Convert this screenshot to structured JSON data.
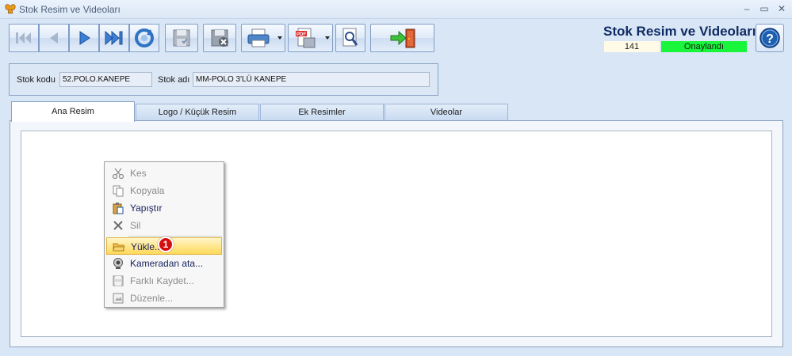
{
  "window": {
    "title": "Stok Resim ve Videoları"
  },
  "header": {
    "title": "Stok Resim ve Videoları",
    "record_no": "141",
    "status": "Onaylandı",
    "status_color": "#19f53a"
  },
  "toolbar": {
    "buttons": [
      {
        "name": "first-record",
        "icon": "first-icon"
      },
      {
        "name": "previous-record",
        "icon": "prev-icon"
      },
      {
        "name": "next-record",
        "icon": "next-icon"
      },
      {
        "name": "last-record",
        "icon": "last-icon"
      },
      {
        "name": "refresh",
        "icon": "refresh-icon"
      },
      {
        "name": "save",
        "icon": "save-icon"
      },
      {
        "name": "delete",
        "icon": "save-delete-icon"
      },
      {
        "name": "print",
        "icon": "printer-icon"
      },
      {
        "name": "export-pdf",
        "icon": "pdf-icon"
      },
      {
        "name": "preview",
        "icon": "search-icon"
      },
      {
        "name": "exit",
        "icon": "exit-icon"
      }
    ]
  },
  "form": {
    "stok_kodu_label": "Stok kodu",
    "stok_kodu_value": "52.POLO.KANEPE",
    "stok_adi_label": "Stok adı",
    "stok_adi_value": "MM-POLO 3'LÜ KANEPE"
  },
  "tabs": [
    {
      "label": "Ana Resim",
      "active": true
    },
    {
      "label": "Logo / Küçük Resim",
      "active": false
    },
    {
      "label": "Ek Resimler",
      "active": false
    },
    {
      "label": "Videolar",
      "active": false
    }
  ],
  "context_menu": {
    "items": [
      {
        "label": "Kes",
        "icon": "scissors-icon",
        "enabled": false
      },
      {
        "label": "Kopyala",
        "icon": "copy-icon",
        "enabled": false
      },
      {
        "label": "Yapıştır",
        "icon": "paste-icon",
        "enabled": true
      },
      {
        "label": "Sil",
        "icon": "delete-x-icon",
        "enabled": false
      },
      {
        "label": "Yükle...",
        "icon": "folder-open-icon",
        "enabled": true,
        "highlighted": true
      },
      {
        "label": "Kameradan ata...",
        "icon": "webcam-icon",
        "enabled": true
      },
      {
        "label": "Farklı Kaydet...",
        "icon": "save-as-icon",
        "enabled": false
      },
      {
        "label": "Düzenle...",
        "icon": "edit-image-icon",
        "enabled": false
      }
    ],
    "step_badge": "1"
  }
}
